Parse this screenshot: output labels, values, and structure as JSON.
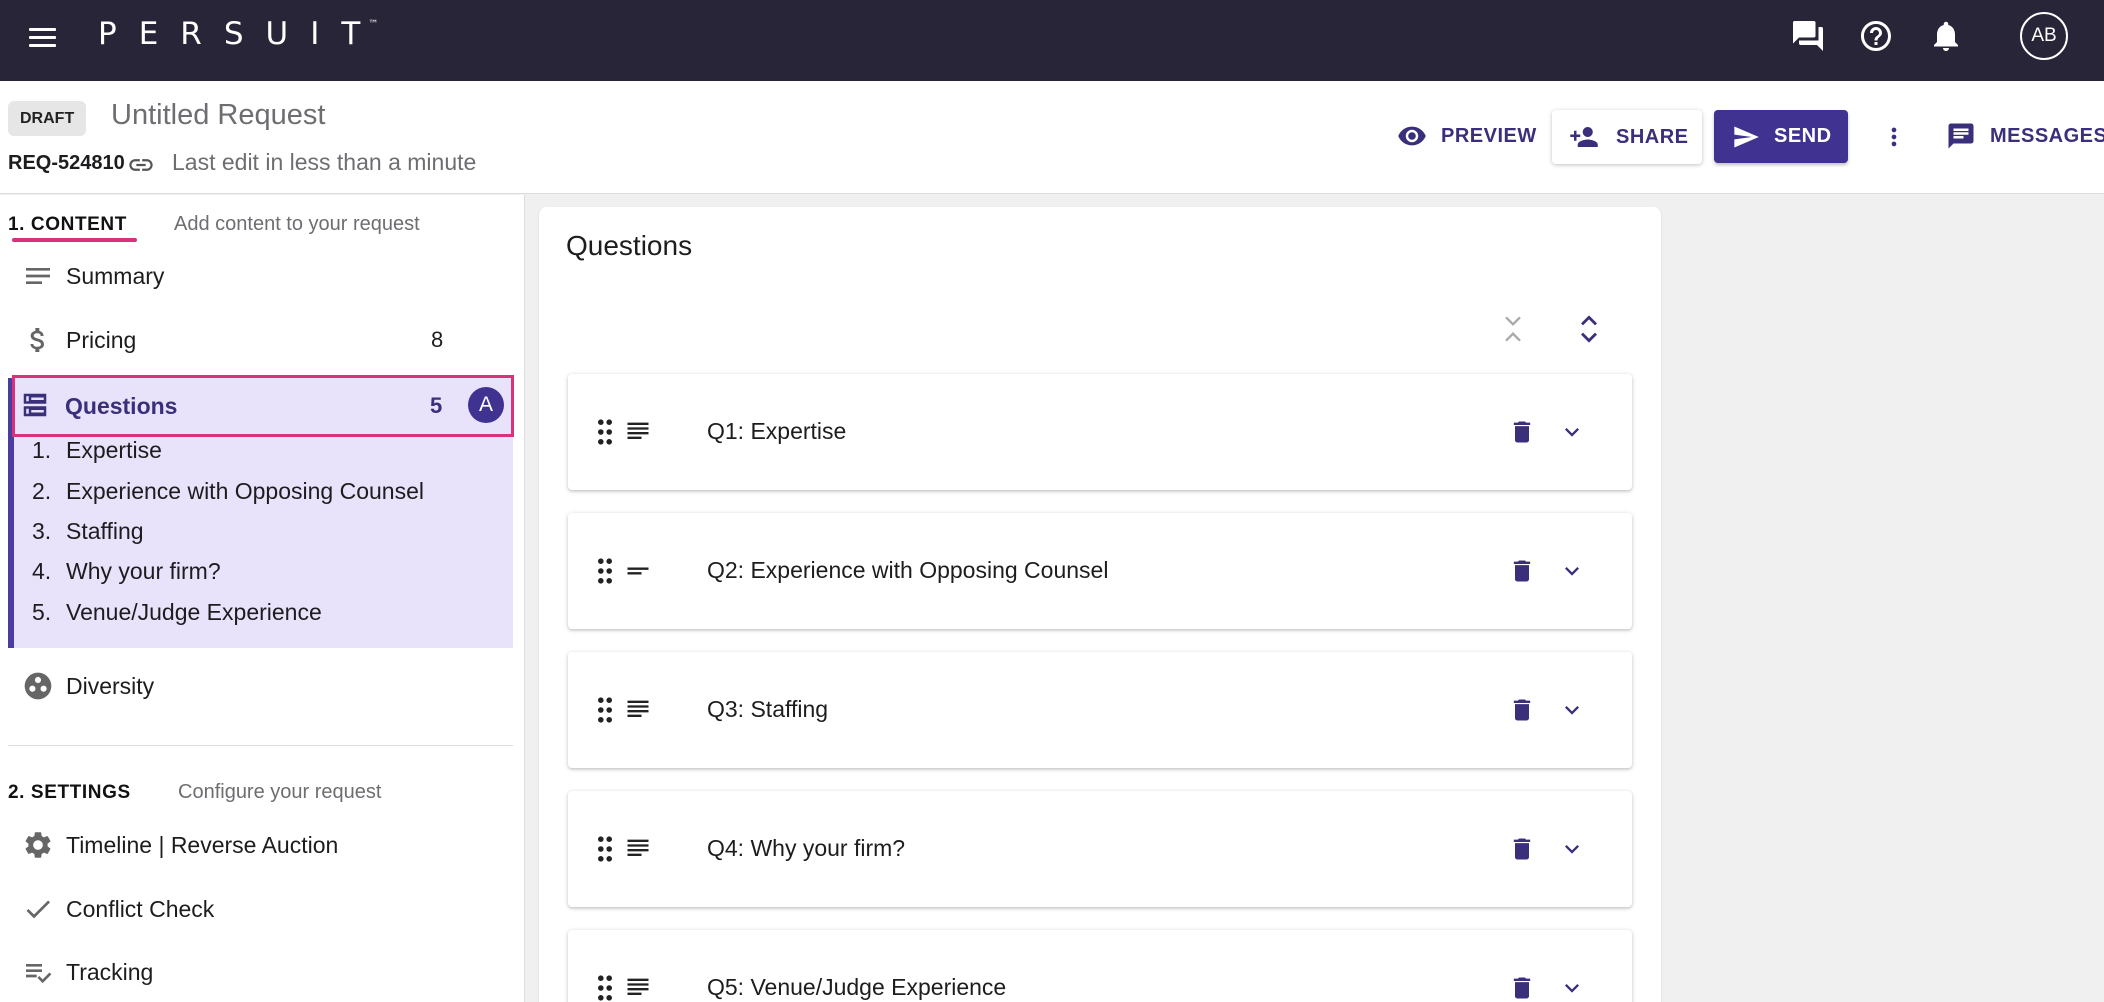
{
  "app": {
    "logo_text": "PERSUIT",
    "logo_tm": "™",
    "avatar_initials": "AB"
  },
  "header": {
    "status_badge": "DRAFT",
    "request_title": "Untitled Request",
    "request_id": "REQ-524810",
    "last_edit": "Last edit in less than a minute",
    "preview_label": "PREVIEW",
    "share_label": "SHARE",
    "send_label": "SEND",
    "messages_label": "MESSAGES"
  },
  "sidebar": {
    "content_step": {
      "label": "1. CONTENT",
      "desc": "Add content to your request"
    },
    "content_items": [
      {
        "label": "Summary",
        "icon": "lines-icon",
        "count": ""
      },
      {
        "label": "Pricing",
        "icon": "dollar-icon",
        "count": "8"
      },
      {
        "label": "Questions",
        "icon": "list-icon",
        "count": "5",
        "badge": "A"
      }
    ],
    "questions": [
      {
        "num": "1.",
        "label": "Expertise"
      },
      {
        "num": "2.",
        "label": "Experience with Opposing Counsel"
      },
      {
        "num": "3.",
        "label": "Staffing"
      },
      {
        "num": "4.",
        "label": "Why your firm?"
      },
      {
        "num": "5.",
        "label": "Venue/Judge Experience"
      }
    ],
    "diversity_label": "Diversity",
    "settings_step": {
      "label": "2. SETTINGS",
      "desc": "Configure your request"
    },
    "settings_items": [
      {
        "label": "Timeline | Reverse Auction",
        "icon": "gear-icon"
      },
      {
        "label": "Conflict Check",
        "icon": "check-icon"
      },
      {
        "label": "Tracking",
        "icon": "checklist-icon"
      }
    ]
  },
  "main": {
    "title": "Questions",
    "questions": [
      {
        "title": "Q1: Expertise",
        "type_icon": "long-text-icon"
      },
      {
        "title": "Q2: Experience with Opposing Counsel",
        "type_icon": "short-text-icon"
      },
      {
        "title": "Q3: Staffing",
        "type_icon": "long-text-icon"
      },
      {
        "title": "Q4: Why your firm?",
        "type_icon": "long-text-icon"
      },
      {
        "title": "Q5: Venue/Judge Experience",
        "type_icon": "long-text-icon"
      }
    ]
  },
  "colors": {
    "topbar": "#272537",
    "accent": "#3f3290",
    "highlight": "#d8327a",
    "selected_bg": "#e8e2fa"
  }
}
